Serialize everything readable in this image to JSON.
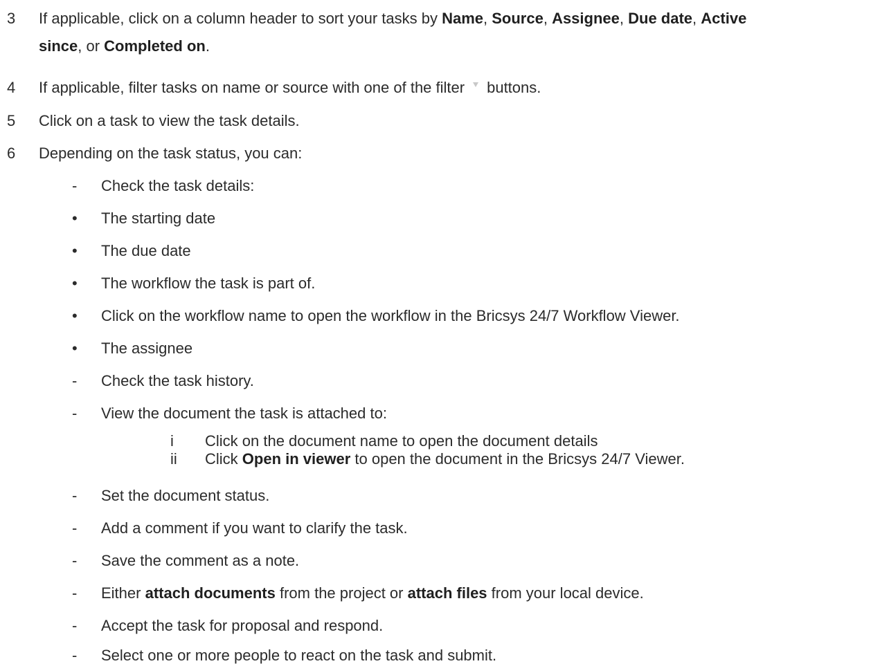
{
  "steps": [
    {
      "number": "3",
      "line1": {
        "prefix": "If applicable, click on a column header to sort your tasks by ",
        "name": "Name",
        "sep1": ", ",
        "source": "Source",
        "sep2": ", ",
        "assignee": "Assignee",
        "sep3": ", ",
        "due_date": "Due date",
        "sep4": ", ",
        "active": "Active"
      },
      "line2": {
        "since": "since",
        "middle": ", or ",
        "completed_on": "Completed on",
        "end": "."
      }
    },
    {
      "number": "4",
      "before_icon": "If applicable, filter tasks on name or source with one of the filter",
      "icon": "filter-icon",
      "after_icon": "buttons."
    },
    {
      "number": "5",
      "text": "Click on a task to view the task details."
    },
    {
      "number": "6",
      "text": "Depending on the task status, you can:"
    }
  ],
  "dash": "-",
  "bullet": "•",
  "sub_items": {
    "check_details": "Check the task details:",
    "starting_date": "The starting date",
    "due_date": "The due date",
    "workflow": "The workflow the task is part of.",
    "click_workflow": "Click on the workflow name to open the workflow in the Bricsys 24/7 Workflow Viewer.",
    "assignee": "The assignee",
    "check_history": "Check the task history.",
    "view_document": "View the document the task is attached to:",
    "set_status": "Set the document status.",
    "add_comment": "Add a comment if you want to clarify the task.",
    "save_comment": "Save the comment as a note.",
    "attach": {
      "prefix": "Either ",
      "attach_documents": "attach documents",
      "middle": " from the project or ",
      "attach_files": "attach files",
      "suffix": " from your local device."
    },
    "accept": "Accept the task for proposal and respond.",
    "select_people": "Select one or more people to react on the task and submit."
  },
  "roman_items": [
    {
      "marker": "i",
      "text": "Click on the document name to open the document details"
    },
    {
      "marker": "ii",
      "prefix": "Click ",
      "bold": "Open in viewer",
      "suffix": " to open the document in the Bricsys 24/7 Viewer."
    }
  ]
}
